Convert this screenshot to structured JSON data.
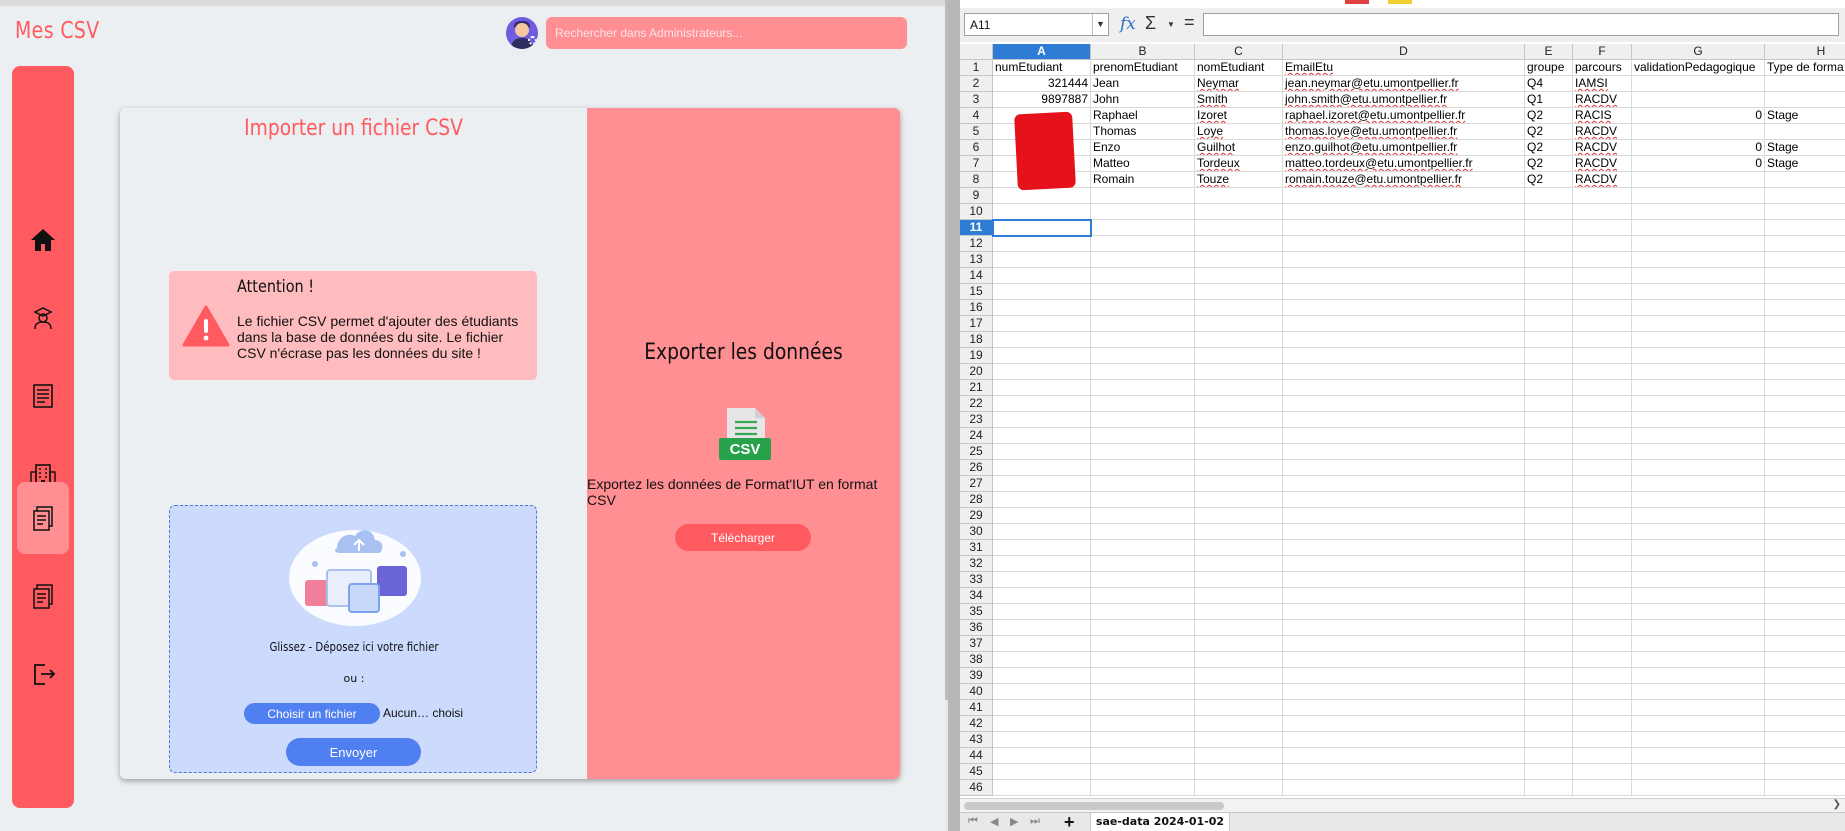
{
  "app": {
    "title": "Mes CSV",
    "search_placeholder": "Rechercher dans Administrateurs..."
  },
  "sidebar": {
    "items": [
      {
        "icon": "home-icon",
        "label": "Accueil"
      },
      {
        "icon": "student-icon",
        "label": "Étudiants"
      },
      {
        "icon": "list-icon",
        "label": "Liste"
      },
      {
        "icon": "building-icon",
        "label": "Entreprises"
      },
      {
        "icon": "csv-document-icon",
        "label": "Mes CSV",
        "active": true
      },
      {
        "icon": "document-icon",
        "label": "Documents"
      },
      {
        "icon": "logout-icon",
        "label": "Déconnexion"
      }
    ]
  },
  "import": {
    "title": "Importer un fichier CSV",
    "alert_title": "Attention !",
    "alert_text": "Le fichier CSV permet d'ajouter des étudiants dans la base de données du site. Le fichier CSV n'écrase pas les données du site !",
    "drop_text": "Glissez - Déposez ici votre fichier",
    "or_text": "ou :",
    "choose_label": "Choisir un fichier",
    "file_status": "Aucun… choisi",
    "send_label": "Envoyer"
  },
  "export": {
    "title": "Exporter les données",
    "icon_label": "CSV",
    "text": "Exportez les données de Format'IUT en format CSV",
    "download_label": "Télécharger"
  },
  "spreadsheet": {
    "name_box": "A11",
    "formula": "",
    "active_cell": "A11",
    "columns": [
      "A",
      "B",
      "C",
      "D",
      "E",
      "F",
      "G",
      "H"
    ],
    "selected_column": "A",
    "row_count": 46,
    "headers": [
      "numEtudiant",
      "prenomEtudiant",
      "nomEtudiant",
      "EmailEtu",
      "groupe",
      "parcours",
      "validationPedagogique",
      "Type de forma"
    ],
    "rows": [
      [
        "321444",
        "Jean",
        "Neymar",
        "jean.neymar@etu.umontpellier.fr",
        "Q4",
        "IAMSI",
        "",
        ""
      ],
      [
        "9897887",
        "John",
        "Smith",
        "john.smith@etu.umontpellier.fr",
        "Q1",
        "RACDV",
        "",
        ""
      ],
      [
        "",
        "Raphael",
        "Izoret",
        "raphael.izoret@etu.umontpellier.fr",
        "Q2",
        "RACIS",
        "0",
        "Stage"
      ],
      [
        "",
        "Thomas",
        "Loye",
        "thomas.loye@etu.umontpellier.fr",
        "Q2",
        "RACDV",
        "",
        ""
      ],
      [
        "",
        "Enzo",
        "Guilhot",
        "enzo.guilhot@etu.umontpellier.fr",
        "Q2",
        "RACDV",
        "0",
        "Stage"
      ],
      [
        "",
        "Matteo",
        "Tordeux",
        "matteo.tordeux@etu.umontpellier.fr",
        "Q2",
        "RACDV",
        "0",
        "Stage"
      ],
      [
        "",
        "Romain",
        "Touze",
        "romain.touze@etu.umontpellier.fr",
        "Q2",
        "RACDV",
        "",
        ""
      ]
    ],
    "sheet_tab": "sae-data 2024-01-02"
  },
  "colors": {
    "brand": "#ff5a5f",
    "brand_light": "#ff8f93",
    "dropzone": "#cbdafd",
    "button_blue": "#4f7ff0",
    "selection": "#2f7cd4"
  }
}
